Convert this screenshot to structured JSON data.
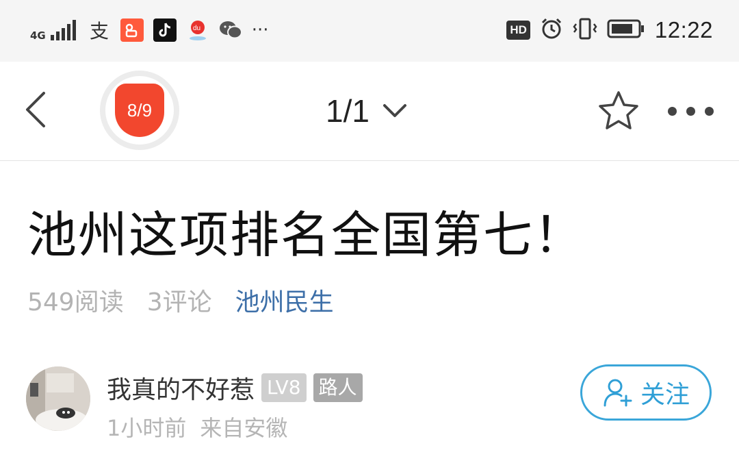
{
  "status_bar": {
    "signal": "4G",
    "time": "12:22",
    "hd_label": "HD",
    "more_notifications": "···",
    "app_icons": [
      "alipay-icon",
      "kuaishou-icon",
      "tiktok-icon",
      "baidu-maps-icon",
      "wechat-icon"
    ]
  },
  "nav": {
    "progress_badge": "8/9",
    "page_indicator": "1/1",
    "icons": [
      "back-chevron-icon",
      "chevron-down-icon",
      "star-icon",
      "more-icon"
    ]
  },
  "article": {
    "title": "池州这项排名全国第七！",
    "reads": "549阅读",
    "comments": "3评论",
    "topic": "池州民生"
  },
  "author": {
    "name": "我真的不好惹",
    "level": "LV8",
    "rank": "路人",
    "time": "1小时前",
    "location": "来自安徽",
    "follow_label": "关注"
  },
  "colors": {
    "accent_red": "#f2472e",
    "topic_blue": "#3d6fa8",
    "follow_blue": "#2f9fd6",
    "muted_gray": "#b3b3b3"
  }
}
